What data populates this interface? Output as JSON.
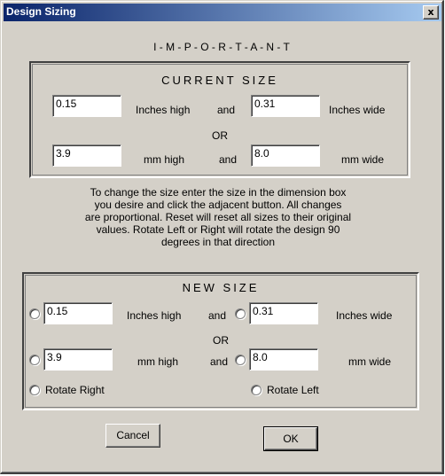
{
  "window": {
    "title": "Design Sizing",
    "close_glyph": "x"
  },
  "important_heading": "I - M - P - O - R - T - A - N - T",
  "current_size": {
    "title": "CURRENT SIZE",
    "inches_high": "0.15",
    "inches_high_label": "Inches high",
    "and_1": "and",
    "inches_wide": "0.31",
    "inches_wide_label": "Inches wide",
    "or": "OR",
    "mm_high": "3.9",
    "mm_high_label": "mm high",
    "and_2": "and",
    "mm_wide": "8.0",
    "mm_wide_label": "mm wide"
  },
  "instructions": [
    "To change the size enter the size in the dimension box",
    "you desire and click the adjacent button.  All changes",
    "are proportional.  Reset will reset all sizes to their original",
    "values. Rotate Left or Right will rotate the design 90",
    "degrees in that direction"
  ],
  "new_size": {
    "title": "NEW SIZE",
    "inches_high": "0.15",
    "inches_high_label": "Inches high",
    "and_1": "and",
    "inches_wide": "0.31",
    "inches_wide_label": "Inches wide",
    "or": "OR",
    "mm_high": "3.9",
    "mm_high_label": "mm high",
    "and_2": "and",
    "mm_wide": "8.0",
    "mm_wide_label": "mm wide",
    "rotate_right": "Rotate Right",
    "rotate_left": "Rotate Left"
  },
  "buttons": {
    "cancel": "Cancel",
    "ok": "OK"
  },
  "colors": {
    "titlebar_start": "#0a246a",
    "titlebar_end": "#a6caf0",
    "face": "#d4d0c8"
  }
}
